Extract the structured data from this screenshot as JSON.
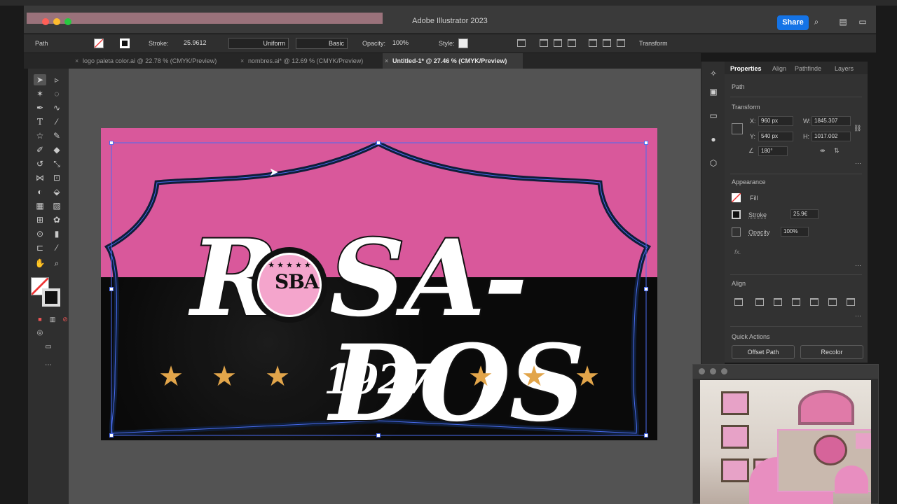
{
  "window": {
    "title": "Adobe Illustrator 2023",
    "share_label": "Share"
  },
  "control_bar": {
    "selection_type": "Path",
    "stroke_label": "Stroke:",
    "stroke_value": "25.9612",
    "profile_value": "Uniform",
    "brush_value": "Basic",
    "opacity_label": "Opacity:",
    "opacity_value": "100%",
    "style_label": "Style:",
    "transform_label": "Transform"
  },
  "tabs": [
    {
      "label": "logo paleta color.ai @ 22.78 % (CMYK/Preview)",
      "active": false
    },
    {
      "label": "nombres.ai* @ 12.69 % (CMYK/Preview)",
      "active": false
    },
    {
      "label": "Untitled-1* @ 27.46 % (CMYK/Preview)",
      "active": true
    }
  ],
  "artwork": {
    "name_left": "R",
    "name_right": "SA-DOS",
    "badge_letters": "SBA",
    "badge_stars": "★ ★ ★ ★ ★",
    "year": "1927",
    "star_glyph": "★",
    "colors": {
      "pink": "#d9589b",
      "badge_pink": "#f4a5cc",
      "star": "#e2a54a",
      "black": "#0b0b0b"
    }
  },
  "properties": {
    "tabs": [
      "Properties",
      "Align",
      "Pathfinde",
      "Layers"
    ],
    "object_type": "Path",
    "transform_title": "Transform",
    "x_label": "X:",
    "x_value": "960 px",
    "y_label": "Y:",
    "y_value": "540 px",
    "w_label": "W:",
    "w_value": "1845.307",
    "h_label": "H:",
    "h_value": "1017.002",
    "angle_value": "180°",
    "appearance_title": "Appearance",
    "fill_label": "Fill",
    "stroke_label": "Stroke",
    "stroke_value": "25.9€",
    "opacity_label": "Opacity",
    "opacity_value": "100%",
    "fx_label": "fx.",
    "align_title": "Align",
    "quick_actions_title": "Quick Actions",
    "offset_path_label": "Offset Path",
    "recolor_label": "Recolor"
  }
}
